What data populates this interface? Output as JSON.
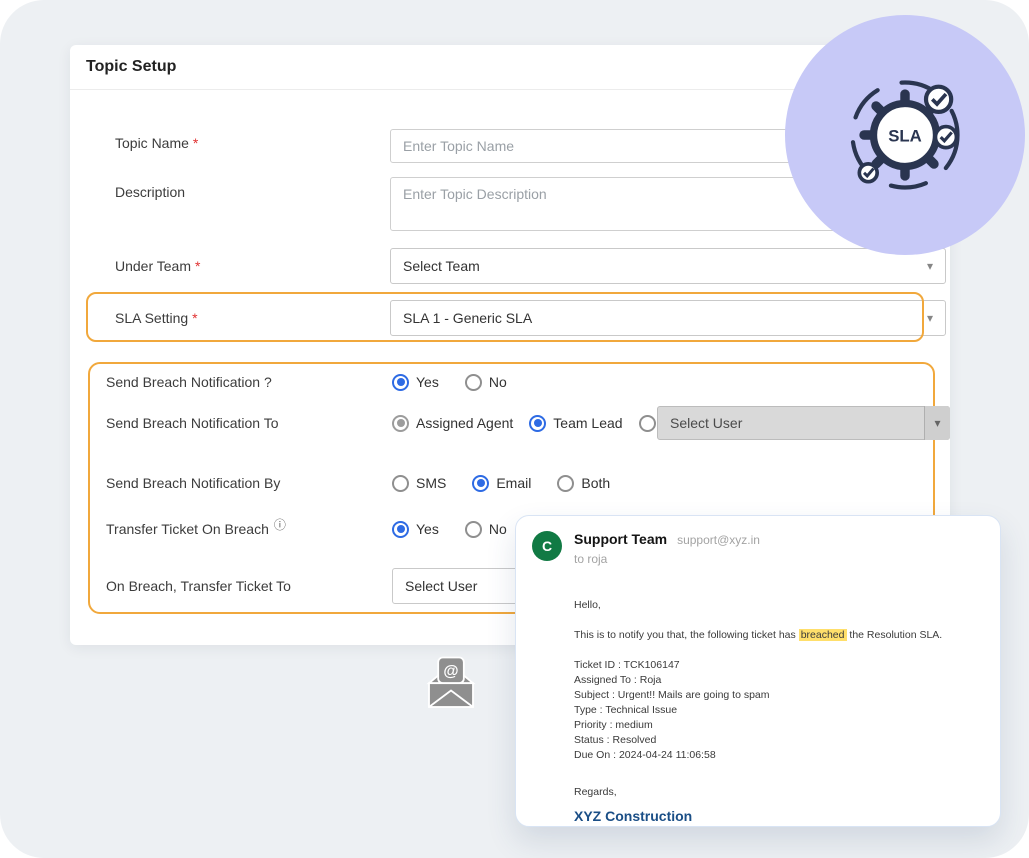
{
  "page": {
    "background": "#edf0f3",
    "accent_orange": "#f1a83c",
    "radio_blue": "#2e6be4",
    "lavender": "#c7c9f7",
    "avatar_green": "#117a44"
  },
  "icons": {
    "caret": "▾",
    "info": "ⓘ",
    "sla_badge_text": "SLA",
    "envelope_at": "@"
  },
  "form": {
    "title": "Topic Setup",
    "required_marker": "*",
    "topic_name_label": "Topic Name",
    "topic_name_placeholder": "Enter Topic Name",
    "description_label": "Description",
    "description_placeholder": "Enter Topic Description",
    "under_team_label": "Under Team",
    "under_team_value": "Select Team",
    "sla_setting_label": "SLA Setting",
    "sla_setting_value": "SLA 1 - Generic SLA",
    "breach_notification_label": "Send Breach Notification ?",
    "breach_to_label": "Send Breach Notification To",
    "breach_by_label": "Send Breach Notification By",
    "transfer_label": "Transfer Ticket On Breach",
    "transfer_to_label": "On Breach, Transfer Ticket To",
    "yes": "Yes",
    "no": "No",
    "assigned_agent": "Assigned Agent",
    "team_lead": "Team Lead",
    "sms": "SMS",
    "email": "Email",
    "both": "Both",
    "select_user_value": "Select User",
    "transfer_to_value": "Select User"
  },
  "email_preview": {
    "avatar_initial": "C",
    "sender_name": "Support Team",
    "sender_email": "support@xyz.in",
    "to_line": "to roja",
    "greeting": "Hello,",
    "body_prefix": "This is to notify you that, the following ticket has ",
    "body_highlight": "breached",
    "body_suffix": " the Resolution SLA.",
    "details": [
      "Ticket ID : TCK106147",
      "Assigned To : Roja",
      "Subject : Urgent!! Mails are going to spam",
      "Type : Technical Issue",
      "Priority : medium",
      "Status : Resolved",
      "Due On : 2024-04-24 11:06:58"
    ],
    "closing": "Regards,",
    "signature": "XYZ Construction"
  }
}
